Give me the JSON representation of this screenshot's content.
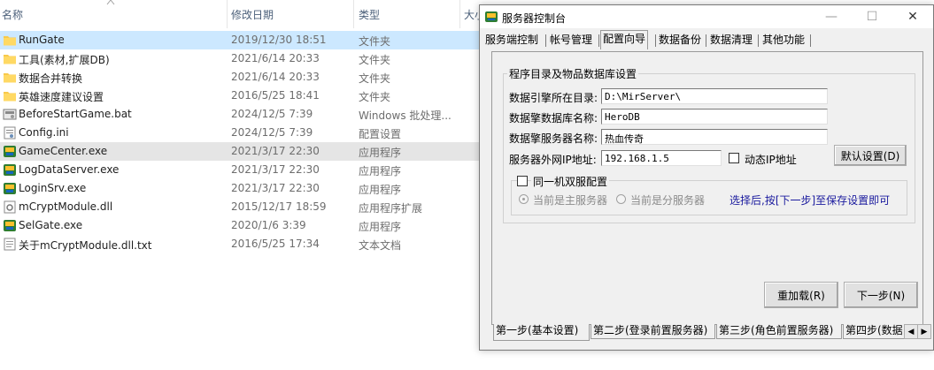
{
  "explorer": {
    "columns": {
      "name": "名称",
      "date": "修改日期",
      "type": "类型",
      "size": "大小"
    },
    "files": [
      {
        "name": "RunGate",
        "date": "2019/12/30 18:51",
        "type": "文件夹",
        "icon": "folder-icon"
      },
      {
        "name": "工具(素材,扩展DB)",
        "date": "2021/6/14 20:33",
        "type": "文件夹",
        "icon": "folder-icon"
      },
      {
        "name": "数据合并转换",
        "date": "2021/6/14 20:33",
        "type": "文件夹",
        "icon": "folder-icon"
      },
      {
        "name": "英雄速度建议设置",
        "date": "2016/5/25 18:41",
        "type": "文件夹",
        "icon": "folder-icon"
      },
      {
        "name": "BeforeStartGame.bat",
        "date": "2024/12/5 7:39",
        "type": "Windows 批处理...",
        "icon": "batch-file-icon"
      },
      {
        "name": "Config.ini",
        "date": "2024/12/5 7:39",
        "type": "配置设置",
        "icon": "ini-file-icon"
      },
      {
        "name": "GameCenter.exe",
        "date": "2021/3/17 22:30",
        "type": "应用程序",
        "icon": "exe-app-icon"
      },
      {
        "name": "LogDataServer.exe",
        "date": "2021/3/17 22:30",
        "type": "应用程序",
        "icon": "exe-app-icon"
      },
      {
        "name": "LoginSrv.exe",
        "date": "2021/3/17 22:30",
        "type": "应用程序",
        "icon": "exe-app-icon"
      },
      {
        "name": "mCryptModule.dll",
        "date": "2015/12/17 18:59",
        "type": "应用程序扩展",
        "icon": "dll-file-icon"
      },
      {
        "name": "SelGate.exe",
        "date": "2020/1/6 3:39",
        "type": "应用程序",
        "icon": "exe-app-icon"
      },
      {
        "name": "关于mCryptModule.dll.txt",
        "date": "2016/5/25 17:34",
        "type": "文本文档",
        "icon": "text-file-icon"
      }
    ]
  },
  "dialog": {
    "title": "服务器控制台",
    "tabs": [
      "服务端控制",
      "帐号管理",
      "配置向导",
      "数据备份",
      "数据清理",
      "其他功能"
    ],
    "active_tab": "配置向导",
    "group_title": "程序目录及物品数据库设置",
    "fields": {
      "engine_dir_label": "数据引擎所在目录:",
      "engine_dir_value": "D:\\MirServer\\",
      "db_name_label": "数据擎数据库名称:",
      "db_name_value": "HeroDB",
      "server_name_label": "数据擎服务器名称:",
      "server_name_value": "热血传奇",
      "ip_label": "服务器外网IP地址:",
      "ip_value": "192.168.1.5",
      "dynamic_ip_label": "动态IP地址"
    },
    "default_button": "默认设置(D)",
    "dual_server_label": "同一机双服配置",
    "radio_master": "当前是主服务器",
    "radio_slave": "当前是分服务器",
    "hint": "选择后,按[下一步]至保存设置即可",
    "reload_button": "重加载(R)",
    "next_button": "下一步(N)",
    "steps": [
      "第一步(基本设置)",
      "第二步(登录前置服务器)",
      "第三步(角色前置服务器)",
      "第四步(数据"
    ]
  }
}
